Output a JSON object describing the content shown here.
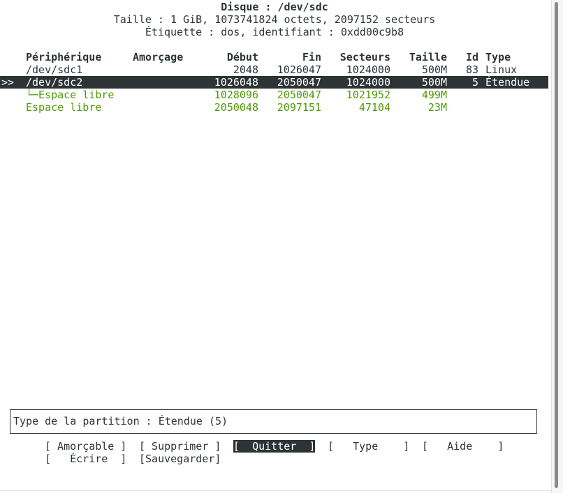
{
  "header": {
    "disk_line": "Disque : /dev/sdc",
    "size_line": "Taille : 1 GiB, 1073741824 octets, 2097152 secteurs",
    "label_line": "Étiquette : dos, identifiant : 0xdd00c9b8"
  },
  "table": {
    "columns": {
      "device": "Périphérique",
      "boot": "Amorçage",
      "start": "Début",
      "end": "Fin",
      "sectors": "Secteurs",
      "size": "Taille",
      "id": "Id",
      "type": "Type"
    },
    "rows": [
      {
        "marker": "",
        "device": "/dev/sdc1",
        "boot": "",
        "start": "2048",
        "end": "1026047",
        "sectors": "1024000",
        "size": "500M",
        "id": "83",
        "type": "Linux"
      },
      {
        "marker": ">>",
        "device": "/dev/sdc2",
        "boot": "",
        "start": "1026048",
        "end": "2050047",
        "sectors": "1024000",
        "size": "500M",
        "id": "5",
        "type": "Étendue"
      },
      {
        "marker": "",
        "device": "└─Espace libre",
        "boot": "",
        "start": "1028096",
        "end": "2050047",
        "sectors": "1021952",
        "size": "499M",
        "id": "",
        "type": ""
      },
      {
        "marker": "",
        "device": "Espace libre",
        "boot": "",
        "start": "2050048",
        "end": "2097151",
        "sectors": "47104",
        "size": "23M",
        "id": "",
        "type": ""
      }
    ]
  },
  "info": {
    "text": "Type de la partition : Étendue (5)"
  },
  "menu": {
    "bootable": "[ Amorçable ]",
    "delete": "[ Supprimer ]",
    "quit": "[  Quitter  ]",
    "type": "[   Type    ]",
    "help": "[   Aide    ]",
    "write": "[   Écrire  ]",
    "dump": "[Sauvegarder]"
  },
  "colors": {
    "foreground": "#2e3436",
    "free_space": "#4e9a06",
    "selection_bg": "#2e3436",
    "selection_fg": "#ffffff"
  }
}
